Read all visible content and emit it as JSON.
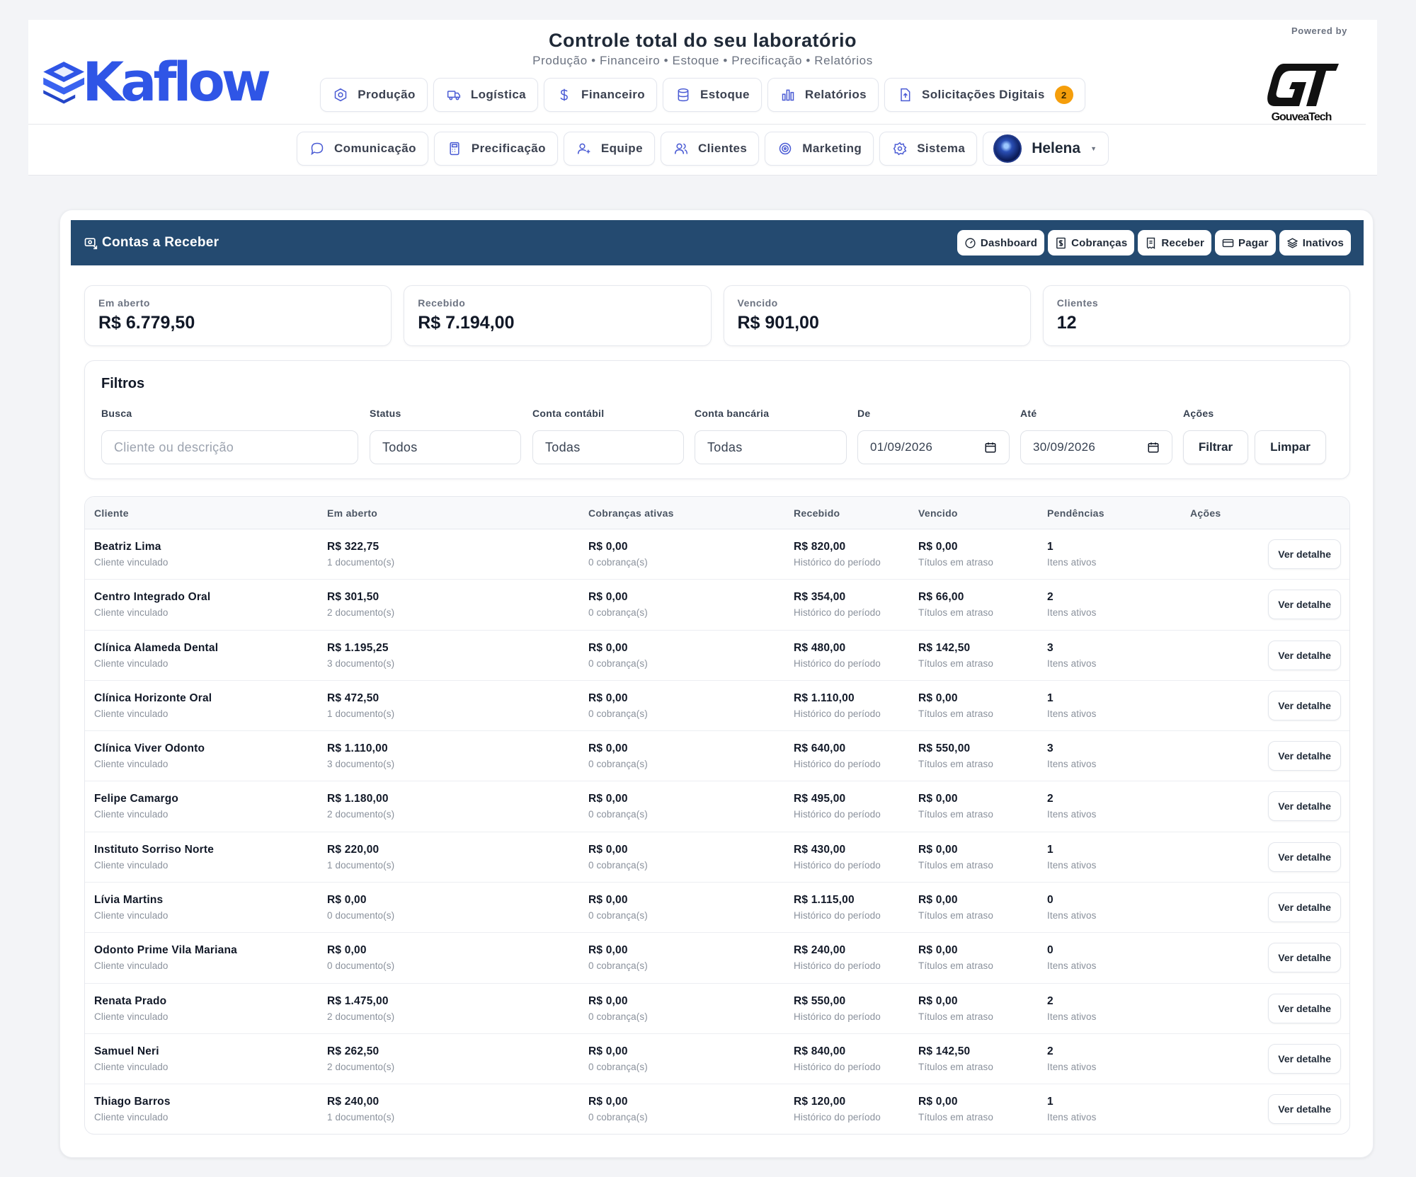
{
  "brand": {
    "name": "Kaflow"
  },
  "header": {
    "title": "Controle total do seu laboratório",
    "subtitle": "Produção • Financeiro • Estoque • Precificação • Relatórios",
    "powered_by": "Powered by",
    "partner_logo_text": "GouveaTech"
  },
  "nav_row1": [
    {
      "label": "Produção",
      "icon": "gear-hex-icon"
    },
    {
      "label": "Logística",
      "icon": "truck-icon"
    },
    {
      "label": "Financeiro",
      "icon": "dollar-icon"
    },
    {
      "label": "Estoque",
      "icon": "database-icon"
    },
    {
      "label": "Relatórios",
      "icon": "bar-chart-icon"
    },
    {
      "label": "Solicitações Digitais",
      "icon": "file-upload-icon",
      "badge": "2"
    }
  ],
  "nav_row2": [
    {
      "label": "Comunicação",
      "icon": "chat-bubble-icon"
    },
    {
      "label": "Precificação",
      "icon": "calculator-icon"
    },
    {
      "label": "Equipe",
      "icon": "user-plus-icon"
    },
    {
      "label": "Clientes",
      "icon": "users-icon"
    },
    {
      "label": "Marketing",
      "icon": "target-icon"
    },
    {
      "label": "Sistema",
      "icon": "settings-icon"
    }
  ],
  "user": {
    "name": "Helena"
  },
  "panel": {
    "title": "Contas a Receber",
    "actions": [
      {
        "label": "Dashboard",
        "icon": "gauge-icon"
      },
      {
        "label": "Cobranças",
        "icon": "invoice-dollar-icon"
      },
      {
        "label": "Receber",
        "icon": "receipt-icon"
      },
      {
        "label": "Pagar",
        "icon": "credit-card-icon"
      },
      {
        "label": "Inativos",
        "icon": "archive-stack-icon"
      }
    ]
  },
  "kpis": [
    {
      "label": "Em aberto",
      "value": "R$ 6.779,50"
    },
    {
      "label": "Recebido",
      "value": "R$ 7.194,00"
    },
    {
      "label": "Vencido",
      "value": "R$ 901,00"
    },
    {
      "label": "Clientes",
      "value": "12"
    }
  ],
  "filters": {
    "title": "Filtros",
    "busca_label": "Busca",
    "busca_placeholder": "Cliente ou descrição",
    "status_label": "Status",
    "status_value": "Todos",
    "conta_contabil_label": "Conta contábil",
    "conta_contabil_value": "Todas",
    "conta_bancaria_label": "Conta bancária",
    "conta_bancaria_value": "Todas",
    "de_label": "De",
    "de_value": "01/09/2026",
    "ate_label": "Até",
    "ate_value": "30/09/2026",
    "acoes_label": "Ações",
    "filtrar": "Filtrar",
    "limpar": "Limpar"
  },
  "table": {
    "columns": [
      "Cliente",
      "Em aberto",
      "Cobranças ativas",
      "Recebido",
      "Vencido",
      "Pendências",
      "Ações"
    ],
    "action_label": "Ver detalhe",
    "rows": [
      {
        "cliente": "Beatriz Lima",
        "cliente_sub": "Cliente vinculado",
        "aberto": "R$ 322,75",
        "aberto_sub": "1 documento(s)",
        "cobrancas": "R$ 0,00",
        "cobrancas_sub": "0 cobrança(s)",
        "recebido": "R$ 820,00",
        "recebido_sub": "Histórico do período",
        "vencido": "R$ 0,00",
        "vencido_sub": "Títulos em atraso",
        "pend": "1",
        "pend_sub": "Itens ativos"
      },
      {
        "cliente": "Centro Integrado Oral",
        "cliente_sub": "Cliente vinculado",
        "aberto": "R$ 301,50",
        "aberto_sub": "2 documento(s)",
        "cobrancas": "R$ 0,00",
        "cobrancas_sub": "0 cobrança(s)",
        "recebido": "R$ 354,00",
        "recebido_sub": "Histórico do período",
        "vencido": "R$ 66,00",
        "vencido_sub": "Títulos em atraso",
        "pend": "2",
        "pend_sub": "Itens ativos"
      },
      {
        "cliente": "Clínica Alameda Dental",
        "cliente_sub": "Cliente vinculado",
        "aberto": "R$ 1.195,25",
        "aberto_sub": "3 documento(s)",
        "cobrancas": "R$ 0,00",
        "cobrancas_sub": "0 cobrança(s)",
        "recebido": "R$ 480,00",
        "recebido_sub": "Histórico do período",
        "vencido": "R$ 142,50",
        "vencido_sub": "Títulos em atraso",
        "pend": "3",
        "pend_sub": "Itens ativos"
      },
      {
        "cliente": "Clínica Horizonte Oral",
        "cliente_sub": "Cliente vinculado",
        "aberto": "R$ 472,50",
        "aberto_sub": "1 documento(s)",
        "cobrancas": "R$ 0,00",
        "cobrancas_sub": "0 cobrança(s)",
        "recebido": "R$ 1.110,00",
        "recebido_sub": "Histórico do período",
        "vencido": "R$ 0,00",
        "vencido_sub": "Títulos em atraso",
        "pend": "1",
        "pend_sub": "Itens ativos"
      },
      {
        "cliente": "Clínica Viver Odonto",
        "cliente_sub": "Cliente vinculado",
        "aberto": "R$ 1.110,00",
        "aberto_sub": "3 documento(s)",
        "cobrancas": "R$ 0,00",
        "cobrancas_sub": "0 cobrança(s)",
        "recebido": "R$ 640,00",
        "recebido_sub": "Histórico do período",
        "vencido": "R$ 550,00",
        "vencido_sub": "Títulos em atraso",
        "pend": "3",
        "pend_sub": "Itens ativos"
      },
      {
        "cliente": "Felipe Camargo",
        "cliente_sub": "Cliente vinculado",
        "aberto": "R$ 1.180,00",
        "aberto_sub": "2 documento(s)",
        "cobrancas": "R$ 0,00",
        "cobrancas_sub": "0 cobrança(s)",
        "recebido": "R$ 495,00",
        "recebido_sub": "Histórico do período",
        "vencido": "R$ 0,00",
        "vencido_sub": "Títulos em atraso",
        "pend": "2",
        "pend_sub": "Itens ativos"
      },
      {
        "cliente": "Instituto Sorriso Norte",
        "cliente_sub": "Cliente vinculado",
        "aberto": "R$ 220,00",
        "aberto_sub": "1 documento(s)",
        "cobrancas": "R$ 0,00",
        "cobrancas_sub": "0 cobrança(s)",
        "recebido": "R$ 430,00",
        "recebido_sub": "Histórico do período",
        "vencido": "R$ 0,00",
        "vencido_sub": "Títulos em atraso",
        "pend": "1",
        "pend_sub": "Itens ativos"
      },
      {
        "cliente": "Lívia Martins",
        "cliente_sub": "Cliente vinculado",
        "aberto": "R$ 0,00",
        "aberto_sub": "0 documento(s)",
        "cobrancas": "R$ 0,00",
        "cobrancas_sub": "0 cobrança(s)",
        "recebido": "R$ 1.115,00",
        "recebido_sub": "Histórico do período",
        "vencido": "R$ 0,00",
        "vencido_sub": "Títulos em atraso",
        "pend": "0",
        "pend_sub": "Itens ativos"
      },
      {
        "cliente": "Odonto Prime Vila Mariana",
        "cliente_sub": "Cliente vinculado",
        "aberto": "R$ 0,00",
        "aberto_sub": "0 documento(s)",
        "cobrancas": "R$ 0,00",
        "cobrancas_sub": "0 cobrança(s)",
        "recebido": "R$ 240,00",
        "recebido_sub": "Histórico do período",
        "vencido": "R$ 0,00",
        "vencido_sub": "Títulos em atraso",
        "pend": "0",
        "pend_sub": "Itens ativos"
      },
      {
        "cliente": "Renata Prado",
        "cliente_sub": "Cliente vinculado",
        "aberto": "R$ 1.475,00",
        "aberto_sub": "2 documento(s)",
        "cobrancas": "R$ 0,00",
        "cobrancas_sub": "0 cobrança(s)",
        "recebido": "R$ 550,00",
        "recebido_sub": "Histórico do período",
        "vencido": "R$ 0,00",
        "vencido_sub": "Títulos em atraso",
        "pend": "2",
        "pend_sub": "Itens ativos"
      },
      {
        "cliente": "Samuel Neri",
        "cliente_sub": "Cliente vinculado",
        "aberto": "R$ 262,50",
        "aberto_sub": "2 documento(s)",
        "cobrancas": "R$ 0,00",
        "cobrancas_sub": "0 cobrança(s)",
        "recebido": "R$ 840,00",
        "recebido_sub": "Histórico do período",
        "vencido": "R$ 142,50",
        "vencido_sub": "Títulos em atraso",
        "pend": "2",
        "pend_sub": "Itens ativos"
      },
      {
        "cliente": "Thiago Barros",
        "cliente_sub": "Cliente vinculado",
        "aberto": "R$ 240,00",
        "aberto_sub": "1 documento(s)",
        "cobrancas": "R$ 0,00",
        "cobrancas_sub": "0 cobrança(s)",
        "recebido": "R$ 120,00",
        "recebido_sub": "Histórico do período",
        "vencido": "R$ 0,00",
        "vencido_sub": "Títulos em atraso",
        "pend": "1",
        "pend_sub": "Itens ativos"
      }
    ]
  },
  "colors": {
    "brand_blue": "#2f55e6",
    "panel_header": "#244a70",
    "badge": "#f59e0b",
    "nav_icon": "#4a5bd4"
  }
}
